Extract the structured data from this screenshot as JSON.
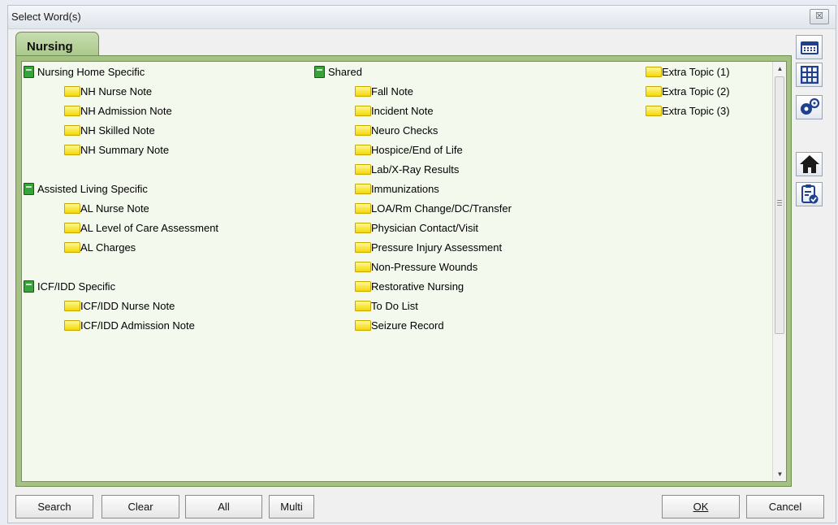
{
  "window": {
    "title": "Select Word(s)",
    "close_glyph": "☒"
  },
  "tab": {
    "label": "Nursing"
  },
  "columns": [
    {
      "groups": [
        {
          "header": "Nursing Home Specific",
          "items": [
            "NH Nurse Note",
            "NH Admission Note",
            "NH Skilled Note",
            "NH Summary Note"
          ]
        },
        {
          "header": "Assisted Living Specific",
          "items": [
            "AL Nurse Note",
            "AL Level of Care Assessment",
            "AL Charges"
          ]
        },
        {
          "header": "ICF/IDD Specific",
          "items": [
            "ICF/IDD Nurse Note",
            "ICF/IDD Admission Note"
          ]
        }
      ]
    },
    {
      "groups": [
        {
          "header": "Shared",
          "items": [
            "Fall Note",
            "Incident Note",
            "Neuro Checks",
            "Hospice/End of Life",
            "Lab/X-Ray Results",
            "Immunizations",
            "LOA/Rm Change/DC/Transfer",
            "Physician Contact/Visit",
            "Pressure Injury Assessment",
            "Non-Pressure Wounds",
            "Restorative Nursing",
            "To Do List",
            "Seizure Record"
          ]
        }
      ]
    },
    {
      "items": [
        "Extra Topic (1)",
        "Extra Topic (2)",
        "Extra Topic (3)"
      ]
    }
  ],
  "sidebar": {
    "icons": [
      "calendar-icon",
      "grid-icon",
      "gears-icon",
      "home-icon",
      "clipboard-check-icon"
    ]
  },
  "buttons": {
    "search": "Search",
    "clear": "Clear",
    "all": "All",
    "multi": "Multi",
    "ok": "OK",
    "cancel": "Cancel"
  }
}
